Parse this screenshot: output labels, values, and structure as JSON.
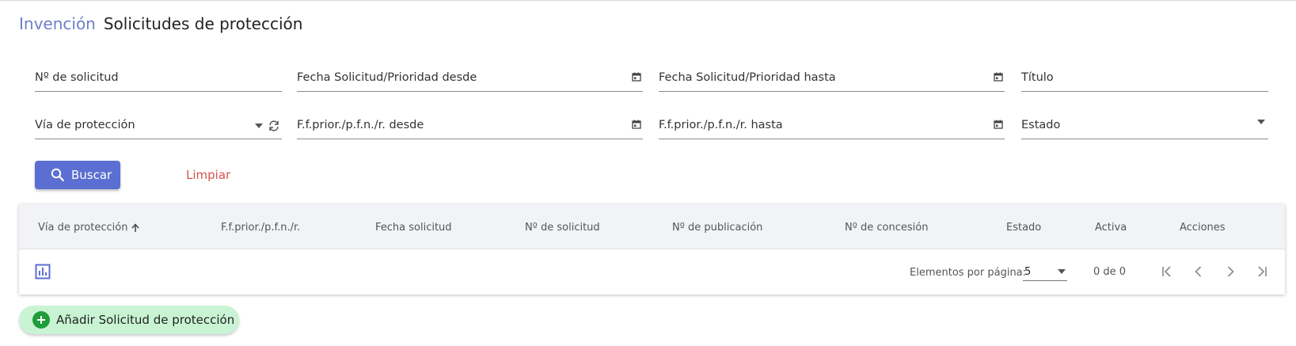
{
  "header": {
    "breadcrumb": "Invención",
    "title": "Solicitudes de protección"
  },
  "filters": {
    "numero_solicitud": "Nº de solicitud",
    "fecha_desde": "Fecha Solicitud/Prioridad desde",
    "fecha_hasta": "Fecha Solicitud/Prioridad hasta",
    "titulo": "Título",
    "via_proteccion": "Vía de protección",
    "ff_desde": "F.f.prior./p.f.n./r. desde",
    "ff_hasta": "F.f.prior./p.f.n./r. hasta",
    "estado": "Estado"
  },
  "actions": {
    "search_label": "Buscar",
    "clear_label": "Limpiar",
    "add_label": "Añadir Solicitud de protección"
  },
  "table": {
    "columns": [
      "Vía de protección",
      "F.f.prior./p.f.n./r.",
      "Fecha solicitud",
      "Nº de solicitud",
      "Nº de publicación",
      "Nº de concesión",
      "Estado",
      "Activa",
      "Acciones"
    ],
    "rows": [],
    "sorted_column": "Vía de protección",
    "sort_direction": "ascending"
  },
  "paginator": {
    "items_per_page_label": "Elementos por página:",
    "page_size": "5",
    "range": "0 de 0"
  },
  "colors": {
    "accent": "#5a6fd1",
    "breadcrumb": "#6b7fc9",
    "clear": "#d9534f",
    "add_bg": "#c9f4d4",
    "add_icon": "#1f9d3a"
  },
  "icons": {
    "search": "search-icon",
    "calendar": "calendar-icon",
    "refresh": "refresh-icon",
    "dropdown": "arrow-drop-down-icon",
    "sort": "arrow-upward-icon",
    "chart": "bar-chart-icon",
    "first": "first-page-icon",
    "prev": "chevron-left-icon",
    "next": "chevron-right-icon",
    "last": "last-page-icon",
    "add": "add-circle-icon"
  }
}
